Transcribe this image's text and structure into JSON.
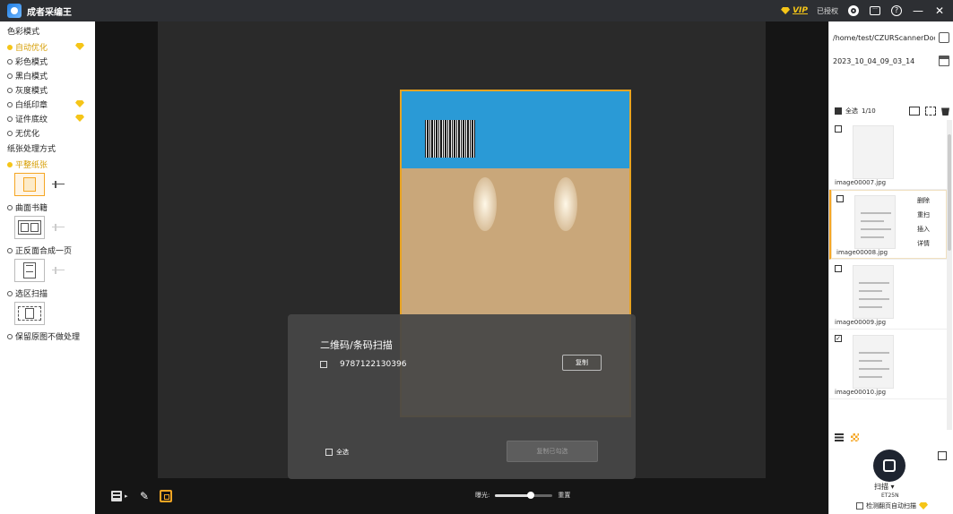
{
  "app": {
    "title": "成者采编王"
  },
  "titlebar": {
    "vip": "VIP",
    "licensed": "已授权"
  },
  "left": {
    "color_mode_title": "色彩模式",
    "color_modes": [
      {
        "label": "自动优化",
        "selected": true,
        "vip": true
      },
      {
        "label": "彩色模式",
        "selected": false,
        "vip": false
      },
      {
        "label": "黑白模式",
        "selected": false,
        "vip": false
      },
      {
        "label": "灰度模式",
        "selected": false,
        "vip": false
      },
      {
        "label": "白纸印章",
        "selected": false,
        "vip": true
      },
      {
        "label": "证件底纹",
        "selected": false,
        "vip": true
      },
      {
        "label": "无优化",
        "selected": false,
        "vip": false
      }
    ],
    "paper_title": "纸张处理方式",
    "paper_modes": [
      "平整纸张",
      "曲面书籍",
      "正反面合成一页",
      "选区扫描",
      "保留原图不做处理"
    ]
  },
  "dialog": {
    "title": "二维码/条码扫描",
    "code": "9787122130396",
    "copy": "复制",
    "select_all": "全选",
    "copy_selected": "复制已勾选"
  },
  "bottom": {
    "exposure_label": "曝光:",
    "reset": "重置",
    "exposure_level": 0.62
  },
  "right": {
    "path": "/home/test/CZURScannerDoc/",
    "folder": "2023_10_04_09_03_14",
    "select_all": "全选",
    "count": "1/10",
    "thumbs": [
      {
        "name": "image00007.jpg",
        "checked": false
      },
      {
        "name": "image00008.jpg",
        "checked": false
      },
      {
        "name": "image00009.jpg",
        "checked": false
      },
      {
        "name": "image00010.jpg",
        "checked": true
      }
    ],
    "context": [
      "删除",
      "重扫",
      "插入",
      "详情"
    ],
    "scan": "扫描 ▾",
    "model": "ET25N",
    "auto_scan": "检测翻页自动扫描"
  }
}
